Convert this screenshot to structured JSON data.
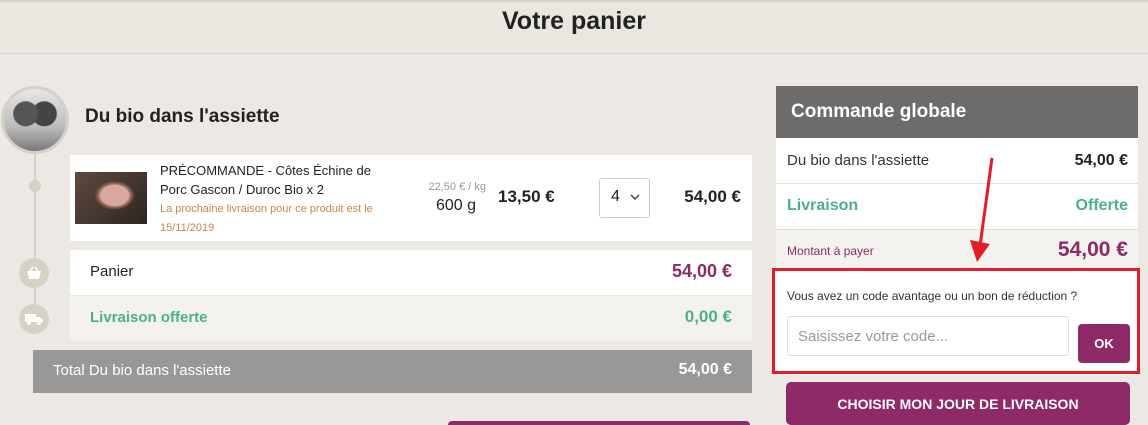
{
  "page": {
    "title": "Votre panier"
  },
  "cart": {
    "producer": "Du bio dans l'assiette",
    "product": {
      "name": "PRÉCOMMANDE - Côtes Échine de Porc Gascon / Duroc Bio x 2",
      "note": "La prochaine livraison pour ce produit est le 15/11/2019",
      "unit_price": "22,50 € / kg",
      "weight": "600 g",
      "price": "13,50 €",
      "quantity": "4",
      "line_total": "54,00 €"
    },
    "basket_label": "Panier",
    "basket_value": "54,00 €",
    "delivery_label": "Livraison offerte",
    "delivery_value": "0,00 €",
    "total_label": "Total Du bio dans l'assiette",
    "total_value": "54,00 €"
  },
  "summary": {
    "title": "Commande globale",
    "producer_label": "Du bio dans l'assiette",
    "producer_value": "54,00 €",
    "delivery_label": "Livraison",
    "delivery_value": "Offerte",
    "amount_label": "Montant à payer",
    "amount_value": "54,00 €",
    "coupon_question": "Vous avez un code avantage ou un bon de réduction ?",
    "coupon_placeholder": "Saisissez votre code...",
    "ok_label": "OK",
    "choose_day_label": "CHOISIR MON JOUR DE LIVRAISON"
  },
  "icons": {
    "basket": "basket-icon",
    "truck": "truck-icon",
    "chevron": "chevron-down-icon"
  },
  "colors": {
    "accent": "#8e2a67",
    "green": "#4caf8f",
    "highlight": "#e21d2a"
  }
}
